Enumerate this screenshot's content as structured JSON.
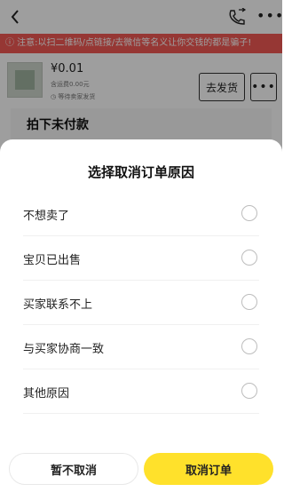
{
  "header": {
    "back_icon": "chevron-left-icon",
    "phone_icon": "phone-icon",
    "more_label": "•••"
  },
  "warning": {
    "text": "ⓘ 注意:以扫二维码/点链接/去微信等名义让你交钱的都是骗子!",
    "color": "#f25a54"
  },
  "order": {
    "price": "¥0.01",
    "shipping": "含运费0.00元",
    "wait_text": "◷ 等待卖家发货",
    "ship_button": "去发货",
    "more_button": "•••"
  },
  "status": {
    "title": "拍下未付款"
  },
  "sheet": {
    "title": "选择取消订单原因",
    "options": [
      {
        "label": "不想卖了"
      },
      {
        "label": "宝贝已出售"
      },
      {
        "label": "买家联系不上"
      },
      {
        "label": "与买家协商一致"
      },
      {
        "label": "其他原因"
      }
    ],
    "keep_button": "暂不取消",
    "cancel_button": "取消订单",
    "accent_color": "#ffe12b"
  }
}
